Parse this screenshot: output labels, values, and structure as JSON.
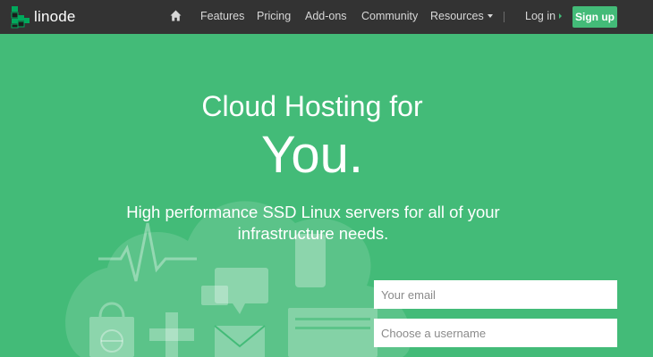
{
  "colors": {
    "brand_green": "#43bb78",
    "nav_bg": "#333333",
    "nav_text": "#d7d7d7"
  },
  "nav": {
    "logo_text": "linode",
    "home_icon": "home-icon",
    "items": [
      "Features",
      "Pricing",
      "Add-ons",
      "Community",
      "Resources"
    ],
    "login_label": "Log in",
    "signup_label": "Sign up"
  },
  "hero": {
    "title": "Cloud Hosting for",
    "title_big": "You.",
    "subtitle_line1": "High performance SSD Linux servers for all of your",
    "subtitle_line2": "infrastructure needs.",
    "background_icons": [
      "cloud-icon",
      "heartbeat-icon",
      "chat-bubble-icon",
      "mobile-phone-icon",
      "shopping-bag-icon",
      "globe-icon",
      "gamepad-cross-icon",
      "mail-icon",
      "browser-window-icon"
    ]
  },
  "form": {
    "email_placeholder": "Your email",
    "username_placeholder": "Choose a username"
  }
}
